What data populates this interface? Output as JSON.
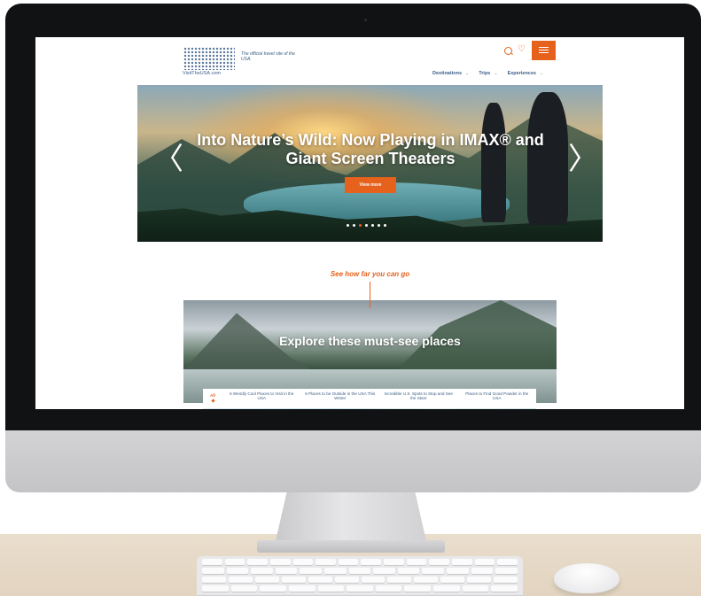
{
  "site": {
    "logo_subtitle": "VisitTheUSA.com",
    "tagline": "The official travel site of the USA.",
    "nav": [
      {
        "label": "Destinations"
      },
      {
        "label": "Trips"
      },
      {
        "label": "Experiences"
      }
    ],
    "hero": {
      "title": "Into Nature’s Wild: Now Playing in IMAX® and Giant Screen Theaters",
      "cta_label": "View more",
      "prev_arrow": "〈",
      "next_arrow": "〉",
      "carousel_total": 7,
      "carousel_active": 2
    },
    "see_how": "See how far you can go",
    "explore": {
      "title": "Explore these must-see places",
      "tabs": [
        "All",
        "5 Weirdly Cool Places to Visit in the USA",
        "6 Places to be Outside in the USA This Winter",
        "Incredible U.S. Spots to Stop and See the Stars",
        "Places to Find Good Powder in the USA"
      ]
    },
    "colors": {
      "accent": "#e6611c",
      "brand_blue": "#3b5e86"
    },
    "icons": [
      "search-icon",
      "heart-icon",
      "hamburger-menu-icon",
      "chevron-left-icon",
      "chevron-right-icon"
    ]
  }
}
